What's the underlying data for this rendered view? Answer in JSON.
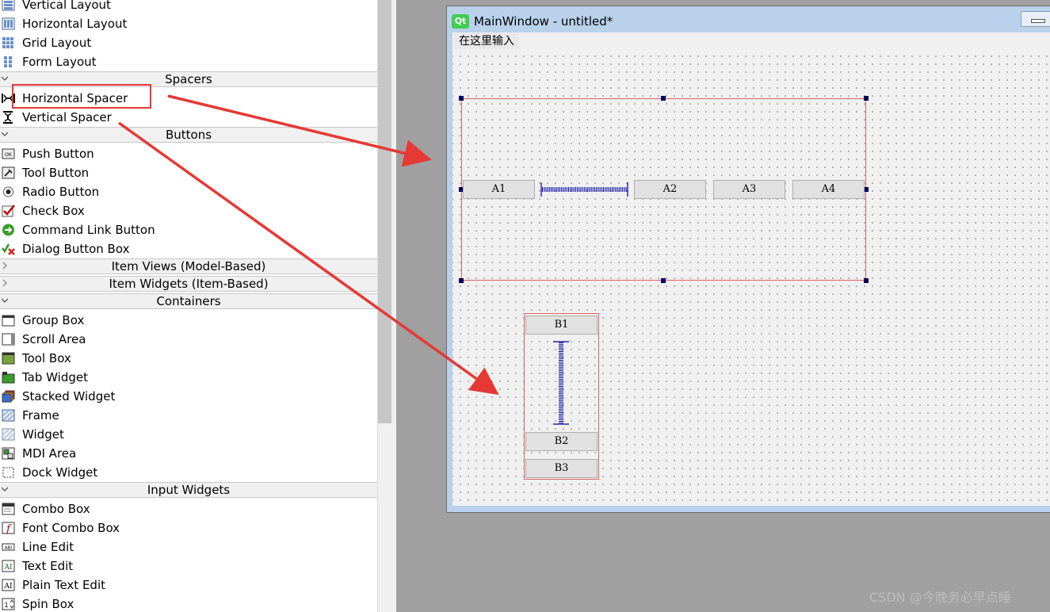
{
  "widget_box": {
    "layouts": [
      {
        "label": "Vertical Layout",
        "icon": "vertical-layout-icon"
      },
      {
        "label": "Horizontal Layout",
        "icon": "horizontal-layout-icon"
      },
      {
        "label": "Grid Layout",
        "icon": "grid-layout-icon"
      },
      {
        "label": "Form Layout",
        "icon": "form-layout-icon"
      }
    ],
    "categories": {
      "spacers": "Spacers",
      "buttons": "Buttons",
      "item_views": "Item Views (Model-Based)",
      "item_widgets": "Item Widgets (Item-Based)",
      "containers": "Containers",
      "input_widgets": "Input Widgets"
    },
    "spacers": [
      {
        "label": "Horizontal Spacer",
        "icon": "horizontal-spacer-icon"
      },
      {
        "label": "Vertical Spacer",
        "icon": "vertical-spacer-icon"
      }
    ],
    "buttons": [
      {
        "label": "Push Button",
        "icon": "push-button-icon"
      },
      {
        "label": "Tool Button",
        "icon": "tool-button-icon"
      },
      {
        "label": "Radio Button",
        "icon": "radio-button-icon"
      },
      {
        "label": "Check Box",
        "icon": "check-box-icon"
      },
      {
        "label": "Command Link Button",
        "icon": "command-link-icon"
      },
      {
        "label": "Dialog Button Box",
        "icon": "dialog-button-box-icon"
      }
    ],
    "containers": [
      {
        "label": "Group Box",
        "icon": "group-box-icon"
      },
      {
        "label": "Scroll Area",
        "icon": "scroll-area-icon"
      },
      {
        "label": "Tool Box",
        "icon": "tool-box-icon"
      },
      {
        "label": "Tab Widget",
        "icon": "tab-widget-icon"
      },
      {
        "label": "Stacked Widget",
        "icon": "stacked-widget-icon"
      },
      {
        "label": "Frame",
        "icon": "frame-icon"
      },
      {
        "label": "Widget",
        "icon": "widget-icon"
      },
      {
        "label": "MDI Area",
        "icon": "mdi-area-icon"
      },
      {
        "label": "Dock Widget",
        "icon": "dock-widget-icon"
      }
    ],
    "input_widgets": [
      {
        "label": "Combo Box",
        "icon": "combo-box-icon"
      },
      {
        "label": "Font Combo Box",
        "icon": "font-combo-box-icon"
      },
      {
        "label": "Line Edit",
        "icon": "line-edit-icon"
      },
      {
        "label": "Text Edit",
        "icon": "text-edit-icon"
      },
      {
        "label": "Plain Text Edit",
        "icon": "plain-text-edit-icon"
      },
      {
        "label": "Spin Box",
        "icon": "spin-box-icon"
      }
    ]
  },
  "form": {
    "window_title": "MainWindow - untitled*",
    "qt_logo": "Qt",
    "menu_placeholder": "在这里输入",
    "horizontal_buttons": [
      "A1",
      "A2",
      "A3",
      "A4"
    ],
    "vertical_buttons": [
      "B1",
      "B2",
      "B3"
    ]
  },
  "watermark": "CSDN @今晚务必早点睡",
  "colors": {
    "annotation": "#e53935",
    "layout_border": "#e06060",
    "handle": "#000060",
    "spacer": "#0000a0"
  }
}
